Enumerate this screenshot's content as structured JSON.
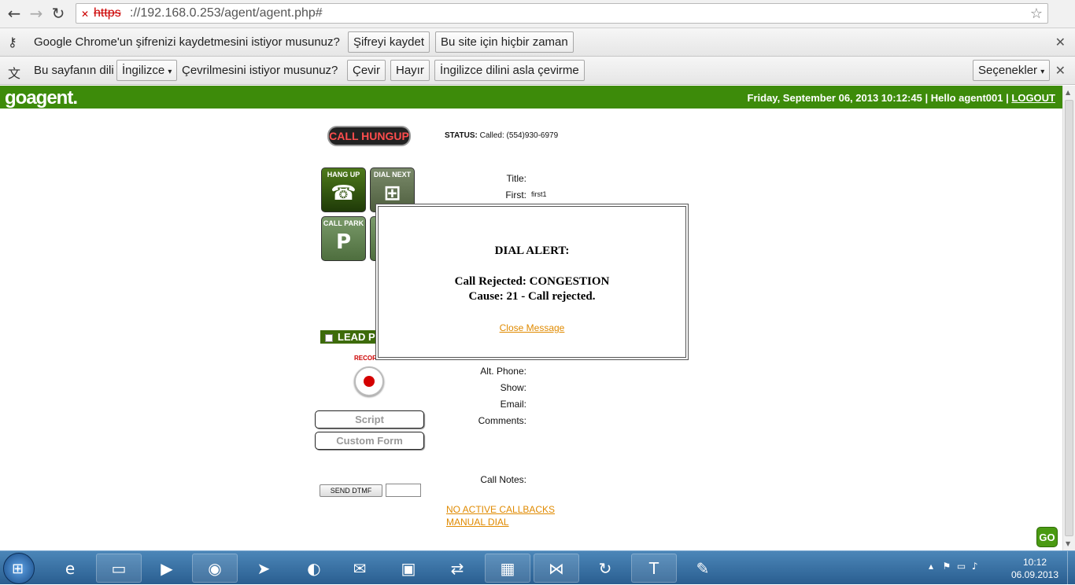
{
  "browser": {
    "url_scheme": "https",
    "url_rest": "://192.168.0.253/agent/agent.php#"
  },
  "password_bar": {
    "message": "Google Chrome'un şifrenizi kaydetmesini istiyor musunuz?",
    "save_label": "Şifreyi kaydet",
    "never_label": "Bu site için hiçbir zaman"
  },
  "translate_bar": {
    "prefix": "Bu sayfanın dili",
    "language": "İngilizce",
    "question": "Çevrilmesini istiyor musunuz?",
    "translate_label": "Çevir",
    "no_label": "Hayır",
    "never_label": "İngilizce dilini asla çevirme",
    "options_label": "Seçenekler"
  },
  "header": {
    "logo": "goagent.",
    "datetime": "Friday, September 06, 2013 10:12:45",
    "separator": "|",
    "greeting": "Hello agent001",
    "logout": "LOGOUT"
  },
  "call": {
    "state": "CALL HUNGUP",
    "status_label": "STATUS:",
    "status_value": "Called: (554)930-6979"
  },
  "tiles": {
    "hangup": "HANG UP",
    "dial_next": "DIAL NEXT",
    "call_park": "CALL PARK"
  },
  "lead": {
    "title_label": "Title:",
    "first_label": "First:",
    "first_value": "first1",
    "alt_phone_label": "Alt. Phone:",
    "show_label": "Show:",
    "email_label": "Email:",
    "comments_label": "Comments:",
    "call_notes_label": "Call Notes:",
    "lead_bar_label": "LEAD P"
  },
  "controls": {
    "record_label": "RECORD",
    "script_label": "Script",
    "custom_form_label": "Custom Form",
    "send_dtmf_label": "SEND DTMF",
    "callbacks_link": "NO ACTIVE CALLBACKS",
    "manual_dial_link": "MANUAL DIAL"
  },
  "alert": {
    "title": "DIAL ALERT:",
    "line1": "Call Rejected: CONGESTION",
    "line2": "Cause: 21 - Call rejected.",
    "close": "Close Message"
  },
  "go_badge": "GO",
  "taskbar": {
    "time": "10:12",
    "date": "06.09.2013"
  },
  "colors": {
    "header_green": "#3d8b0a",
    "link_orange": "#e08a00",
    "alert_red": "#ff4d4d"
  }
}
